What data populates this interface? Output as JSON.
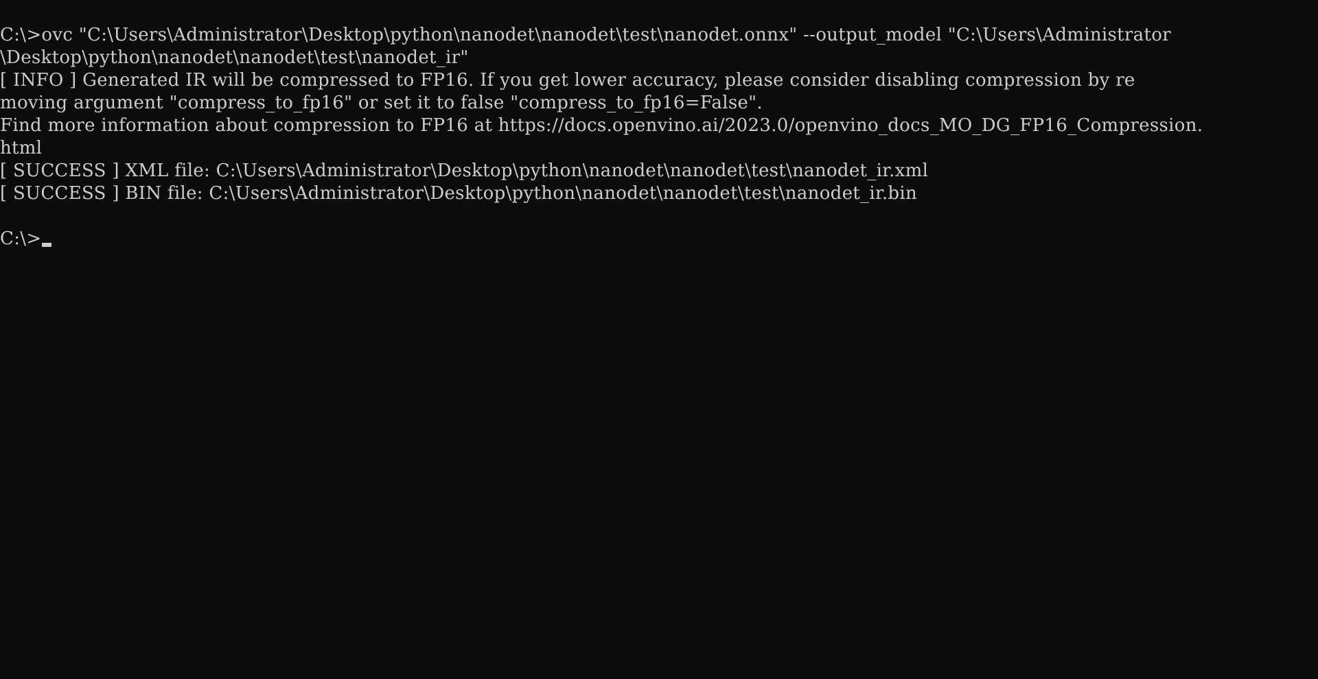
{
  "terminal": {
    "lines": [
      "C:\\>ovc \"C:\\Users\\Administrator\\Desktop\\python\\nanodet\\nanodet\\test\\nanodet.onnx\" --output_model \"C:\\Users\\Administrator",
      "\\Desktop\\python\\nanodet\\nanodet\\test\\nanodet_ir\"",
      "[ INFO ] Generated IR will be compressed to FP16. If you get lower accuracy, please consider disabling compression by re",
      "moving argument \"compress_to_fp16\" or set it to false \"compress_to_fp16=False\".",
      "Find more information about compression to FP16 at https://docs.openvino.ai/2023.0/openvino_docs_MO_DG_FP16_Compression.",
      "html",
      "[ SUCCESS ] XML file: C:\\Users\\Administrator\\Desktop\\python\\nanodet\\nanodet\\test\\nanodet_ir.xml",
      "[ SUCCESS ] BIN file: C:\\Users\\Administrator\\Desktop\\python\\nanodet\\nanodet\\test\\nanodet_ir.bin",
      ""
    ],
    "prompt": "C:\\>"
  },
  "colors": {
    "background": "#0c0c0c",
    "text": "#cccccc"
  }
}
